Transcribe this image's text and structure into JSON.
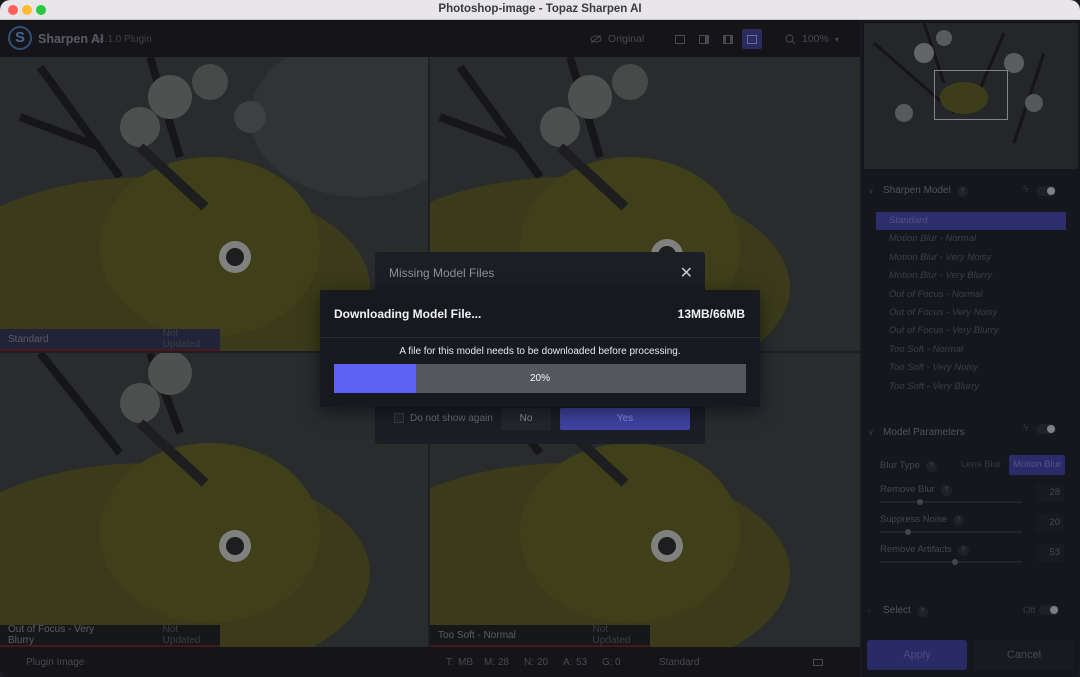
{
  "window": {
    "title": "Photoshop-image - Topaz Sharpen AI"
  },
  "toolbar": {
    "app_name": "Sharpen AI",
    "version": "v4.1.0 Plugin",
    "original_label": "Original",
    "zoom": "100%"
  },
  "panes": [
    {
      "model": "Standard",
      "status": "Not Updated"
    },
    {
      "model": "Out of Focus - Very Blurry",
      "status": "Not Updated"
    },
    {
      "model": "Too Soft - Normal",
      "status": "Not Updated"
    }
  ],
  "statusbar": {
    "source": "Plugin Image",
    "t": "T:",
    "t_val": "MB",
    "m": "M:",
    "m_val": "28",
    "n": "N:",
    "n_val": "20",
    "a": "A:",
    "a_val": "53",
    "g": "G:",
    "g_val": "0",
    "model": "Standard"
  },
  "panel": {
    "sharpen_model_title": "Sharpen Model",
    "models": [
      "Standard",
      "Motion Blur - Normal",
      "Motion Blur - Very Noisy",
      "Motion Blur - Very Blurry",
      "Out of Focus - Normal",
      "Out of Focus - Very Noisy",
      "Out of Focus - Very Blurry",
      "Too Soft - Normal",
      "Too Soft - Very Noisy",
      "Too Soft - Very Blurry"
    ],
    "model_params_title": "Model Parameters",
    "blur_type_label": "Blur Type",
    "lens_blur": "Lens Blur",
    "motion_blur": "Motion Blur",
    "params": [
      {
        "label": "Remove Blur",
        "value": "28",
        "level": 0.28
      },
      {
        "label": "Suppress Noise",
        "value": "20",
        "level": 0.2
      },
      {
        "label": "Remove Artifacts",
        "value": "53",
        "level": 0.53
      }
    ],
    "select_title": "Select",
    "select_state": "Off",
    "apply": "Apply",
    "cancel": "Cancel"
  },
  "dialog_bg": {
    "title": "Missing Model Files",
    "dont_show": "Do not show again",
    "no": "No",
    "yes": "Yes"
  },
  "dialog": {
    "title": "Downloading Model File...",
    "size": "13MB/66MB",
    "message": "A file for this model needs to be downloaded before processing.",
    "progress_text": "20%",
    "progress": 0.2
  },
  "colors": {
    "accent": "#5d62f5",
    "progress_track": "#55575f"
  }
}
